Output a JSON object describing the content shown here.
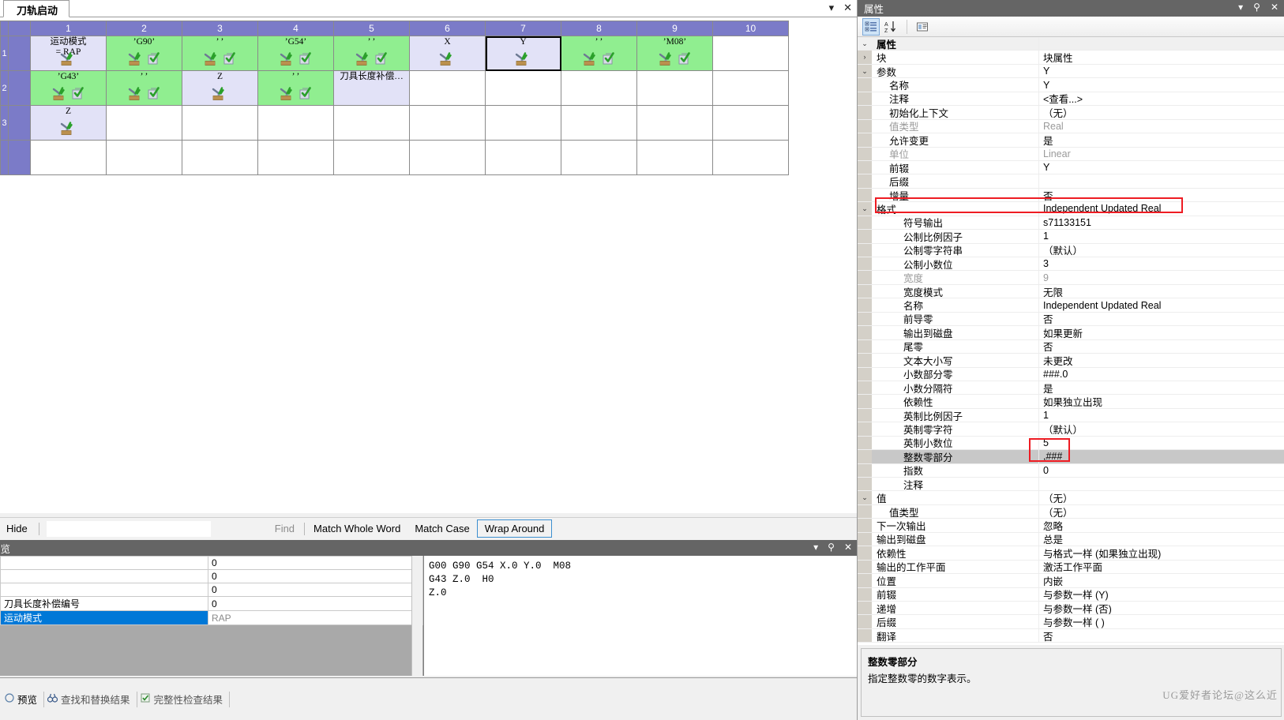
{
  "document_tab": {
    "label": "刀轨启动"
  },
  "tabstrip_controls": [
    {
      "name": "chevron-down-icon",
      "glyph": "▾"
    },
    {
      "name": "close-icon",
      "glyph": "✕"
    }
  ],
  "grid": {
    "column_headers": [
      "1",
      "2",
      "3",
      "4",
      "5",
      "6",
      "7",
      "8",
      "9",
      "10"
    ],
    "row_headers": [
      "1",
      "2",
      "3",
      ""
    ],
    "rows": [
      [
        {
          "text": "运动模式\n= RAP",
          "bg": "lav",
          "icons": [
            "tool-check-icon"
          ]
        },
        {
          "text": "’G90’",
          "bg": "green",
          "icons": [
            "tool-check-icon",
            "block-check-icon"
          ]
        },
        {
          "text": "’ ’",
          "bg": "green",
          "icons": [
            "tool-check-icon",
            "block-check-icon"
          ]
        },
        {
          "text": "’G54’",
          "bg": "green",
          "icons": [
            "tool-check-icon",
            "block-check-icon"
          ]
        },
        {
          "text": "’ ’",
          "bg": "green",
          "icons": [
            "tool-check-icon",
            "block-check-icon"
          ]
        },
        {
          "text": "X",
          "bg": "lav",
          "icons": [
            "tool-check-icon"
          ]
        },
        {
          "text": "Y",
          "bg": "lav",
          "icons": [
            "tool-check-icon"
          ],
          "selected": true
        },
        {
          "text": "’ ’",
          "bg": "green",
          "icons": [
            "tool-check-icon",
            "block-check-icon"
          ]
        },
        {
          "text": "’M08’",
          "bg": "green",
          "icons": [
            "tool-check-icon",
            "block-check-icon"
          ]
        },
        {
          "text": "",
          "bg": "white",
          "icons": []
        }
      ],
      [
        {
          "text": "’G43’",
          "bg": "green",
          "icons": [
            "tool-check-icon",
            "block-check-icon"
          ]
        },
        {
          "text": "’ ’",
          "bg": "green",
          "icons": [
            "tool-check-icon",
            "block-check-icon"
          ]
        },
        {
          "text": "Z",
          "bg": "lav",
          "icons": [
            "tool-check-icon"
          ]
        },
        {
          "text": "’ ’",
          "bg": "green",
          "icons": [
            "tool-check-icon",
            "block-check-icon"
          ]
        },
        {
          "text": "刀具长度补偿…",
          "bg": "lav",
          "icons": []
        },
        {
          "text": "",
          "bg": "white",
          "icons": []
        },
        {
          "text": "",
          "bg": "white",
          "icons": []
        },
        {
          "text": "",
          "bg": "white",
          "icons": []
        },
        {
          "text": "",
          "bg": "white",
          "icons": []
        },
        {
          "text": "",
          "bg": "white",
          "icons": []
        }
      ],
      [
        {
          "text": "Z",
          "bg": "lav",
          "icons": [
            "tool-check-icon"
          ]
        },
        {
          "text": "",
          "bg": "white",
          "icons": []
        },
        {
          "text": "",
          "bg": "white",
          "icons": []
        },
        {
          "text": "",
          "bg": "white",
          "icons": []
        },
        {
          "text": "",
          "bg": "white",
          "icons": []
        },
        {
          "text": "",
          "bg": "white",
          "icons": []
        },
        {
          "text": "",
          "bg": "white",
          "icons": []
        },
        {
          "text": "",
          "bg": "white",
          "icons": []
        },
        {
          "text": "",
          "bg": "white",
          "icons": []
        },
        {
          "text": "",
          "bg": "white",
          "icons": []
        }
      ],
      [
        {
          "text": "",
          "bg": "white",
          "icons": []
        },
        {
          "text": "",
          "bg": "white",
          "icons": []
        },
        {
          "text": "",
          "bg": "white",
          "icons": []
        },
        {
          "text": "",
          "bg": "white",
          "icons": []
        },
        {
          "text": "",
          "bg": "white",
          "icons": []
        },
        {
          "text": "",
          "bg": "white",
          "icons": []
        },
        {
          "text": "",
          "bg": "white",
          "icons": []
        },
        {
          "text": "",
          "bg": "white",
          "icons": []
        },
        {
          "text": "",
          "bg": "white",
          "icons": []
        },
        {
          "text": "",
          "bg": "white",
          "icons": []
        }
      ]
    ]
  },
  "findbar": {
    "hide_label": "Hide",
    "search_value": "",
    "search_placeholder": "",
    "find_label": "Find",
    "match_whole_word_label": "Match Whole Word",
    "match_case_label": "Match Case",
    "wrap_around_label": "Wrap Around"
  },
  "preview_dock": {
    "title": "预览",
    "controls": [
      {
        "name": "chevron-down-icon",
        "glyph": "▾"
      },
      {
        "name": "pin-icon",
        "glyph": "⚲"
      },
      {
        "name": "close-icon",
        "glyph": "✕"
      }
    ],
    "table_rows": [
      {
        "name": "",
        "value": "0",
        "selected": false
      },
      {
        "name": "",
        "value": "0",
        "selected": false
      },
      {
        "name": "",
        "value": "0",
        "selected": false
      },
      {
        "name": "刀具长度补偿编号",
        "value": "0",
        "selected": false
      },
      {
        "name": "运动模式",
        "value": "RAP",
        "selected": true
      }
    ],
    "code_lines": [
      "G00 G90 G54 X.0 Y.0  M08",
      "G43 Z.0  H0",
      "Z.0"
    ]
  },
  "bottom_tabs": [
    {
      "label": "预览",
      "icon": "preview-icon",
      "active": true
    },
    {
      "label": "查找和替换结果",
      "icon": "binoculars-icon",
      "active": false
    },
    {
      "label": "完整性检查结果",
      "icon": "check-doc-icon",
      "active": false
    }
  ],
  "properties_panel": {
    "title": "属性",
    "controls": [
      {
        "name": "chevron-down-icon",
        "glyph": "▾"
      },
      {
        "name": "pin-icon",
        "glyph": "⚲"
      },
      {
        "name": "close-icon",
        "glyph": "✕"
      }
    ],
    "toolbar": [
      {
        "name": "categorized-view-button",
        "glyph": "▤",
        "active": true
      },
      {
        "name": "sort-alphabetical-button",
        "glyph": "A↓",
        "active": false
      },
      {
        "name": "property-pages-button",
        "glyph": "▣",
        "active": false
      }
    ],
    "rows": [
      {
        "key": "属性",
        "value": "",
        "indent": 0,
        "chev": "v",
        "style": "header"
      },
      {
        "key": "块",
        "value": "块属性",
        "indent": 1,
        "chev": ">",
        "style": ""
      },
      {
        "key": "参数",
        "value": "Y",
        "indent": 1,
        "chev": "v",
        "style": ""
      },
      {
        "key": "名称",
        "value": "Y",
        "indent": 2,
        "chev": "",
        "style": ""
      },
      {
        "key": "注释",
        "value": "<查看...>",
        "indent": 2,
        "chev": "",
        "style": ""
      },
      {
        "key": "初始化上下文",
        "value": "（无）",
        "indent": 2,
        "chev": "",
        "style": ""
      },
      {
        "key": "值类型",
        "value": "Real",
        "indent": 2,
        "chev": "",
        "style": "gray"
      },
      {
        "key": "允许变更",
        "value": "是",
        "indent": 2,
        "chev": "",
        "style": ""
      },
      {
        "key": "单位",
        "value": "Linear",
        "indent": 2,
        "chev": "",
        "style": "gray"
      },
      {
        "key": "前辍",
        "value": "Y",
        "indent": 2,
        "chev": "",
        "style": ""
      },
      {
        "key": "后缀",
        "value": "",
        "indent": 2,
        "chev": "",
        "style": ""
      },
      {
        "key": "增量",
        "value": "否",
        "indent": 2,
        "chev": "",
        "style": ""
      },
      {
        "key": "格式",
        "value": "Independent Updated Real",
        "indent": 1,
        "chev": "v",
        "style": ""
      },
      {
        "key": "符号输出",
        "value": "s71133151",
        "indent": 3,
        "chev": "",
        "style": ""
      },
      {
        "key": "公制比例因子",
        "value": "1",
        "indent": 3,
        "chev": "",
        "style": ""
      },
      {
        "key": "公制零字符串",
        "value": "（默认）",
        "indent": 3,
        "chev": "",
        "style": ""
      },
      {
        "key": "公制小数位",
        "value": "3",
        "indent": 3,
        "chev": "",
        "style": ""
      },
      {
        "key": "宽度",
        "value": "9",
        "indent": 3,
        "chev": "",
        "style": "gray"
      },
      {
        "key": "宽度模式",
        "value": "无限",
        "indent": 3,
        "chev": "",
        "style": ""
      },
      {
        "key": "名称",
        "value": "Independent Updated Real",
        "indent": 3,
        "chev": "",
        "style": ""
      },
      {
        "key": "前导零",
        "value": "否",
        "indent": 3,
        "chev": "",
        "style": ""
      },
      {
        "key": "输出到磁盘",
        "value": "如果更新",
        "indent": 3,
        "chev": "",
        "style": ""
      },
      {
        "key": "尾零",
        "value": "否",
        "indent": 3,
        "chev": "",
        "style": ""
      },
      {
        "key": "文本大小写",
        "value": "未更改",
        "indent": 3,
        "chev": "",
        "style": ""
      },
      {
        "key": "小数部分零",
        "value": "###.0",
        "indent": 3,
        "chev": "",
        "style": ""
      },
      {
        "key": "小数分隔符",
        "value": "是",
        "indent": 3,
        "chev": "",
        "style": ""
      },
      {
        "key": "依赖性",
        "value": "如果独立出现",
        "indent": 3,
        "chev": "",
        "style": ""
      },
      {
        "key": "英制比例因子",
        "value": "1",
        "indent": 3,
        "chev": "",
        "style": ""
      },
      {
        "key": "英制零字符",
        "value": "（默认）",
        "indent": 3,
        "chev": "",
        "style": ""
      },
      {
        "key": "英制小数位",
        "value": "5",
        "indent": 3,
        "chev": "",
        "style": ""
      },
      {
        "key": "整数零部分",
        "value": ",###",
        "indent": 3,
        "chev": "",
        "style": "hl"
      },
      {
        "key": "指数",
        "value": "0",
        "indent": 3,
        "chev": "",
        "style": ""
      },
      {
        "key": "注释",
        "value": "",
        "indent": 3,
        "chev": "",
        "style": ""
      },
      {
        "key": "值",
        "value": "（无）",
        "indent": 1,
        "chev": "v",
        "style": ""
      },
      {
        "key": "值类型",
        "value": "（无）",
        "indent": 2,
        "chev": "",
        "style": ""
      },
      {
        "key": "下一次输出",
        "value": "忽略",
        "indent": 1,
        "chev": "",
        "style": ""
      },
      {
        "key": "输出到磁盘",
        "value": "总是",
        "indent": 1,
        "chev": "",
        "style": ""
      },
      {
        "key": "依赖性",
        "value": "与格式一样 (如果独立出现)",
        "indent": 1,
        "chev": "",
        "style": ""
      },
      {
        "key": "输出的工作平面",
        "value": "激活工作平面",
        "indent": 1,
        "chev": "",
        "style": ""
      },
      {
        "key": "位置",
        "value": "内嵌",
        "indent": 1,
        "chev": "",
        "style": ""
      },
      {
        "key": "前辍",
        "value": "与参数一样 (Y)",
        "indent": 1,
        "chev": "",
        "style": ""
      },
      {
        "key": "递增",
        "value": "与参数一样 (否)",
        "indent": 1,
        "chev": "",
        "style": ""
      },
      {
        "key": "后缀",
        "value": "与参数一样 ( )",
        "indent": 1,
        "chev": "",
        "style": ""
      },
      {
        "key": "翻译",
        "value": "否",
        "indent": 1,
        "chev": "",
        "style": ""
      }
    ],
    "description": {
      "title": "整数零部分",
      "text": "指定整数零的数字表示。"
    }
  },
  "watermark": {
    "text": "UG爱好者论坛@这么近"
  },
  "colors": {
    "grid_header": "#7b7bc8",
    "cell_green": "#90ee90",
    "cell_lavender": "#e2e2f7",
    "selection_blue": "#0078d7",
    "annotation_red": "#ee1c23",
    "dock_title_gray": "#656565"
  }
}
